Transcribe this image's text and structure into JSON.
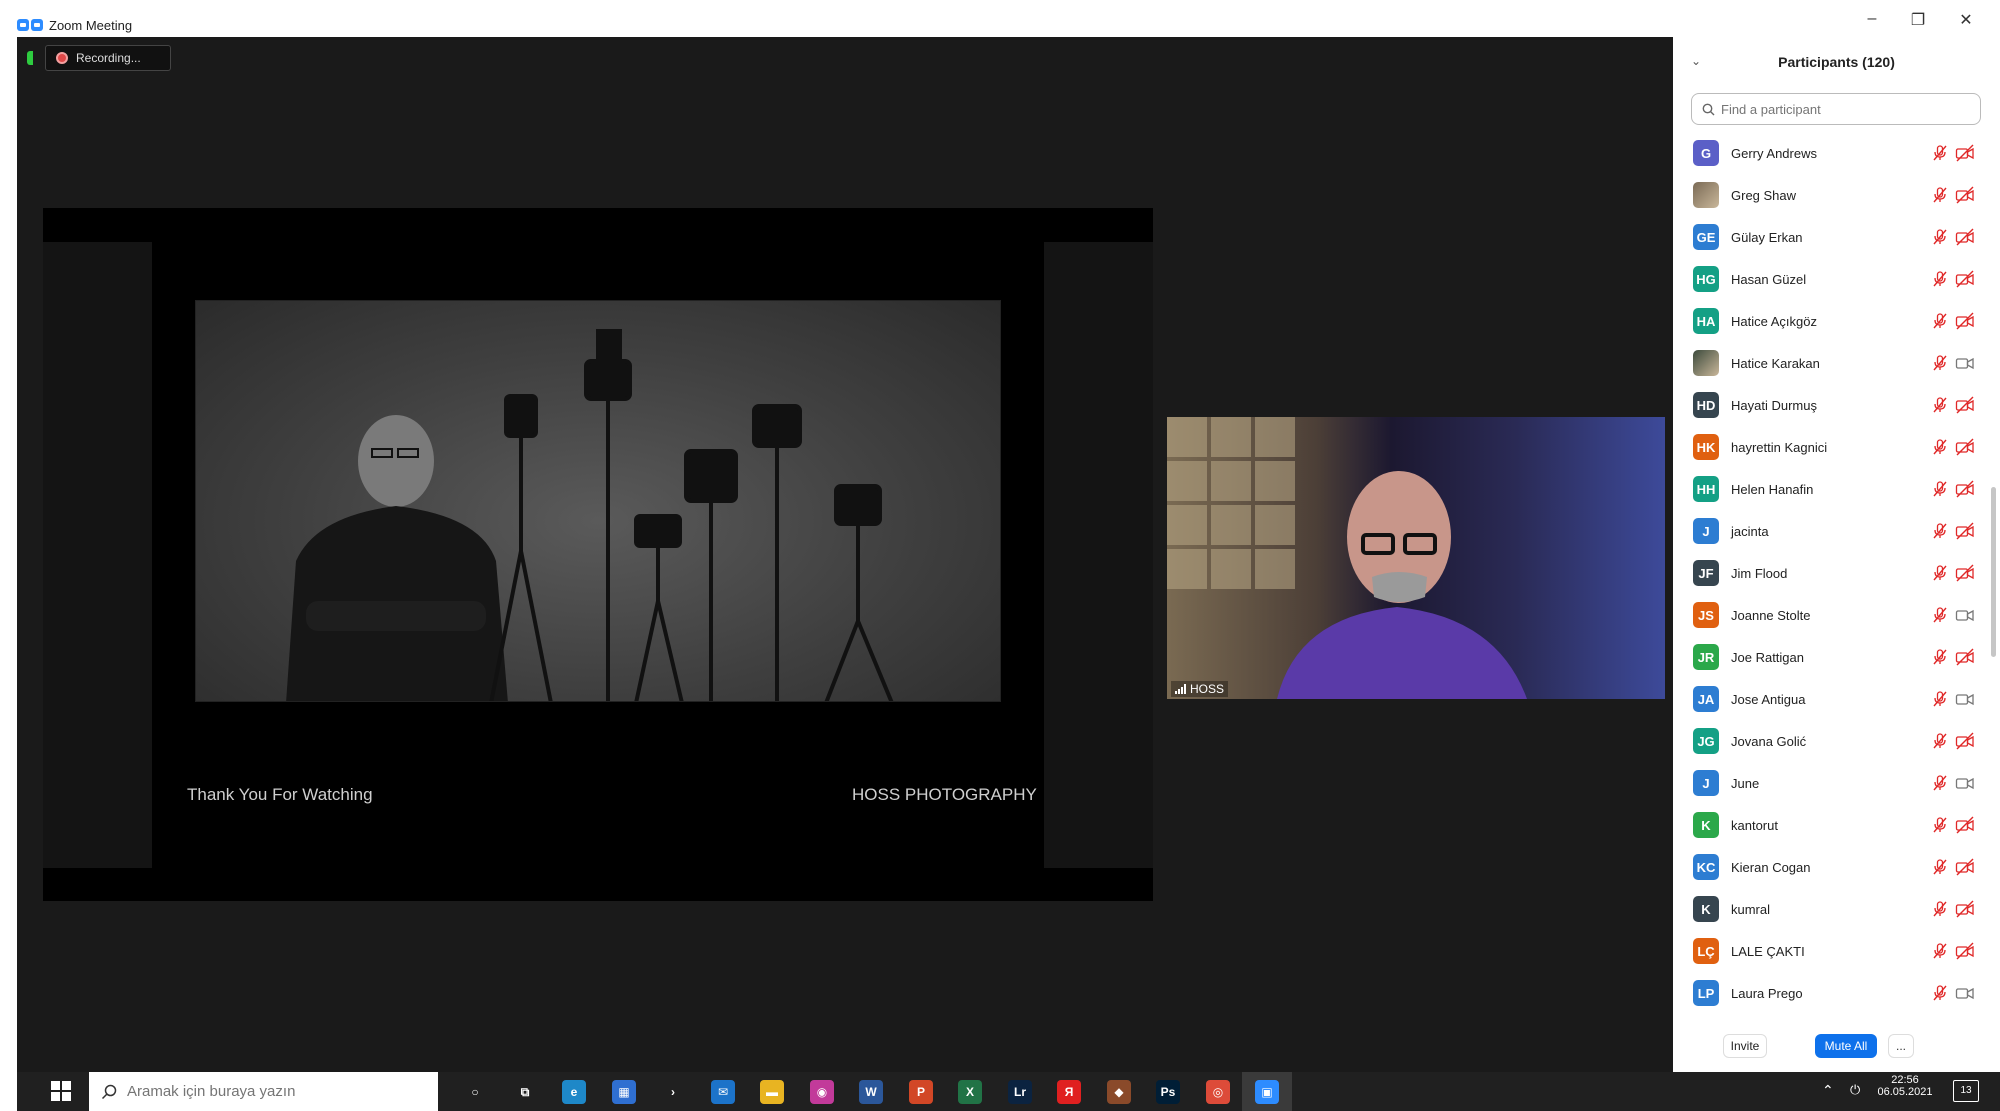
{
  "window": {
    "title": "Zoom Meeting",
    "controls": {
      "minimize": "–",
      "restore": "❐",
      "close": "✕"
    }
  },
  "meeting": {
    "recording_label": "Recording...",
    "slide": {
      "left_text": "Thank You For Watching",
      "right_text": "HOSS PHOTOGRAPHY"
    },
    "video": {
      "name": "HOSS"
    }
  },
  "panel": {
    "title": "Participants (120)",
    "collapse_icon": "chevron-down-icon",
    "search_placeholder": "Find a participant",
    "participants": [
      {
        "initials": "G",
        "name": "Gerry Andrews",
        "color": "#5b5fc7",
        "cam": "off"
      },
      {
        "initials": "",
        "name": "Greg Shaw",
        "color": "#7a6a55",
        "cam": "off",
        "photo": true
      },
      {
        "initials": "GE",
        "name": "Gülay Erkan",
        "color": "#2d7dd2",
        "cam": "off"
      },
      {
        "initials": "HG",
        "name": "Hasan Güzel",
        "color": "#14a085",
        "cam": "off"
      },
      {
        "initials": "HA",
        "name": "Hatice Açıkgöz",
        "color": "#14a085",
        "cam": "off"
      },
      {
        "initials": "",
        "name": "Hatice Karakan",
        "color": "#3c4a3c",
        "cam": "on",
        "photo": true
      },
      {
        "initials": "HD",
        "name": "Hayati Durmuş",
        "color": "#36454f",
        "cam": "off"
      },
      {
        "initials": "HK",
        "name": "hayrettin Kagnici",
        "color": "#e06010",
        "cam": "off"
      },
      {
        "initials": "HH",
        "name": "Helen Hanafin",
        "color": "#14a085",
        "cam": "off"
      },
      {
        "initials": "J",
        "name": "jacinta",
        "color": "#2d7dd2",
        "cam": "off"
      },
      {
        "initials": "JF",
        "name": "Jim Flood",
        "color": "#36454f",
        "cam": "off"
      },
      {
        "initials": "JS",
        "name": "Joanne Stolte",
        "color": "#e06010",
        "cam": "on"
      },
      {
        "initials": "JR",
        "name": "Joe Rattigan",
        "color": "#2ba84a",
        "cam": "off"
      },
      {
        "initials": "JA",
        "name": "Jose Antigua",
        "color": "#2d7dd2",
        "cam": "on"
      },
      {
        "initials": "JG",
        "name": "Jovana Golić",
        "color": "#14a085",
        "cam": "off"
      },
      {
        "initials": "J",
        "name": "June",
        "color": "#2d7dd2",
        "cam": "on"
      },
      {
        "initials": "K",
        "name": "kantorut",
        "color": "#2ba84a",
        "cam": "off"
      },
      {
        "initials": "KC",
        "name": "Kieran Cogan",
        "color": "#2d7dd2",
        "cam": "off"
      },
      {
        "initials": "K",
        "name": "kumral",
        "color": "#36454f",
        "cam": "off"
      },
      {
        "initials": "LÇ",
        "name": "LALE ÇAKTI",
        "color": "#e06010",
        "cam": "off"
      },
      {
        "initials": "LP",
        "name": "Laura Prego",
        "color": "#2d7dd2",
        "cam": "on"
      }
    ],
    "footer": {
      "invite": "Invite",
      "mute_all": "Mute All",
      "more": "..."
    }
  },
  "taskbar": {
    "search_placeholder": "Aramak için buraya yazın",
    "apps": [
      {
        "name": "cortana",
        "label": "○",
        "color": "#202020"
      },
      {
        "name": "taskview",
        "label": "⧉",
        "color": "#202020"
      },
      {
        "name": "edge",
        "label": "e",
        "color": "#1e88c8"
      },
      {
        "name": "store",
        "label": "▦",
        "color": "#2f6fd1"
      },
      {
        "name": "plex",
        "label": "›",
        "color": "#202020"
      },
      {
        "name": "mail",
        "label": "✉",
        "color": "#1c73c9"
      },
      {
        "name": "explorer",
        "label": "▬",
        "color": "#e8b422"
      },
      {
        "name": "photos",
        "label": "◉",
        "color": "#c23a9a"
      },
      {
        "name": "word",
        "label": "W",
        "color": "#2b579a"
      },
      {
        "name": "powerpoint",
        "label": "P",
        "color": "#d24726"
      },
      {
        "name": "excel",
        "label": "X",
        "color": "#217346"
      },
      {
        "name": "lightroom",
        "label": "Lr",
        "color": "#0b2340"
      },
      {
        "name": "yandex",
        "label": "Я",
        "color": "#e02020"
      },
      {
        "name": "package",
        "label": "◆",
        "color": "#8a4a2a"
      },
      {
        "name": "photoshop",
        "label": "Ps",
        "color": "#001e36"
      },
      {
        "name": "chrome",
        "label": "◎",
        "color": "#dd4b39"
      },
      {
        "name": "zoom",
        "label": "▣",
        "color": "#2d8cff"
      }
    ],
    "clock": {
      "time": "22:56",
      "date": "06.05.2021"
    },
    "notifications": "13"
  }
}
